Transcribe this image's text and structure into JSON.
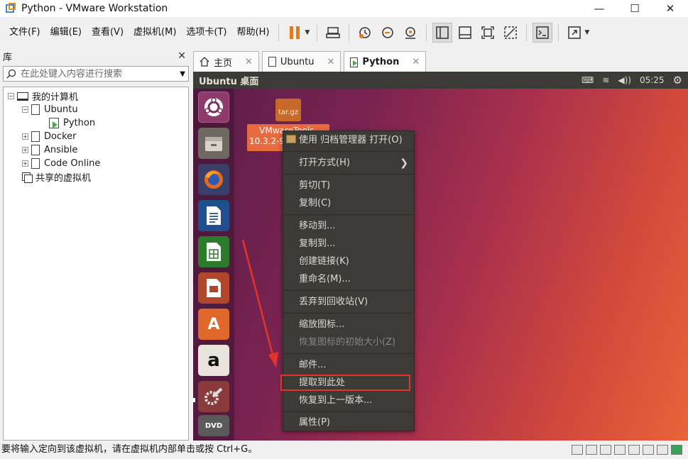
{
  "window": {
    "title": "Python - VMware Workstation",
    "controls": {
      "minimize": "—",
      "maximize": "☐",
      "close": "✕"
    }
  },
  "menubar": {
    "items": [
      "文件(F)",
      "编辑(E)",
      "查看(V)",
      "虚拟机(M)",
      "选项卡(T)",
      "帮助(H)"
    ]
  },
  "toolbar": {
    "icons": [
      "pause-icon",
      "send-keys-icon",
      "snapshot-icon",
      "revert-snapshot-icon",
      "snapshot-manager-icon",
      "library-view-icon",
      "thumbnail-bar-icon",
      "fit-guest-icon",
      "unity-icon",
      "console-icon",
      "fullscreen-icon"
    ],
    "accent": "#e07b1f"
  },
  "library": {
    "title": "库",
    "close": "✕",
    "search_placeholder": "在此处键入内容进行搜索",
    "tree": {
      "root": "我的计算机",
      "ubuntu": "Ubuntu",
      "python": "Python",
      "docker": "Docker",
      "ansible": "Ansible",
      "code_online": "Code Online",
      "shared": "共享的虚拟机"
    }
  },
  "tabs": [
    {
      "label": "主页",
      "close": "✕"
    },
    {
      "label": "Ubuntu",
      "close": "✕"
    },
    {
      "label": "Python",
      "close": "✕"
    }
  ],
  "vm": {
    "topbar_title": "Ubuntu 桌面",
    "clock": "05:25",
    "indicators": {
      "keyboard": "⌨",
      "wifi": "≋",
      "volume": "◀))",
      "gear": "⚙"
    },
    "desktop_file": {
      "icon_text": "tar.gz",
      "label_line1": "VMwareTools-",
      "label_line2": "10.3.2-9"
    },
    "launcher": {
      "icons": [
        "ubuntu-dash-icon",
        "files-icon",
        "firefox-icon",
        "writer-icon",
        "calc-icon",
        "impress-icon",
        "software-center-icon",
        "amazon-icon",
        "settings-icon",
        "dvd-icon"
      ],
      "amazon_glyph": "a",
      "software_glyph": "A",
      "dvd_text": "DVD"
    }
  },
  "context_menu": {
    "open_with_archive": "使用 归档管理器 打开(O)",
    "open_with": "打开方式(H)",
    "cut": "剪切(T)",
    "copy": "复制(C)",
    "move_to": "移动到...",
    "copy_to": "复制到...",
    "make_link": "创建链接(K)",
    "rename": "重命名(M)...",
    "trash": "丢弃到回收站(V)",
    "resize_icon": "缩放图标...",
    "restore_icon_size": "恢复图标的初始大小(Z)",
    "email": "邮件...",
    "extract_here": "提取到此处",
    "restore_previous": "恢复到上一版本...",
    "properties": "属性(P)",
    "highlight_color": "#e3342a"
  },
  "statusbar": {
    "text": "要将输入定向到该虚拟机，请在虚拟机内部单击或按 Ctrl+G。"
  }
}
